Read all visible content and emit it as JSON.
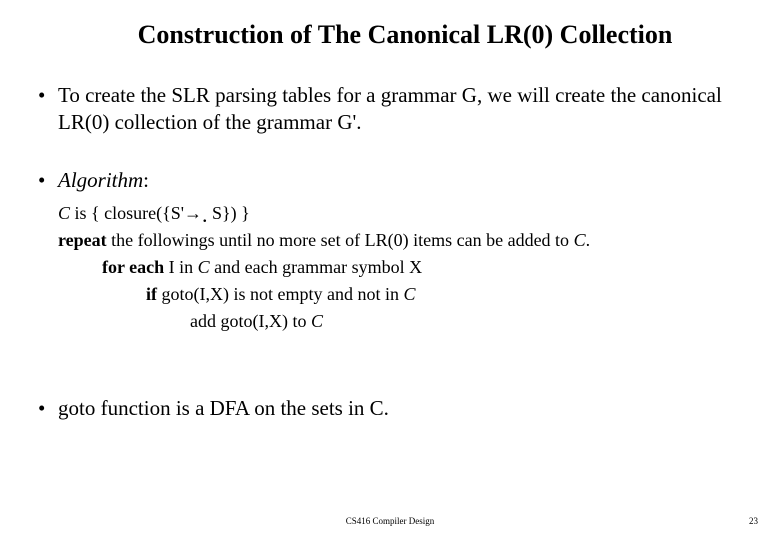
{
  "title": "Construction of The Canonical LR(0) Collection",
  "bullets": {
    "intro": "To create the SLR parsing tables for a grammar G, we will create the canonical LR(0) collection of the grammar G'.",
    "algorithm_label": "Algorithm",
    "goto_note": "goto function is a DFA on the sets in C."
  },
  "algorithm": {
    "c_is_prefix": "C",
    "c_is_text": " is { closure({S'",
    "c_is_suffix": " S}) }",
    "repeat_bold": "repeat",
    "repeat_rest": " the followings until no more set of LR(0) items can be added to ",
    "repeat_c": "C",
    "foreach_bold": "for each",
    "foreach_mid": " I in ",
    "foreach_c": "C",
    "foreach_rest": " and each grammar symbol X",
    "if_bold": "if",
    "if_mid": " goto(I,X) is not empty and not in ",
    "if_c": "C",
    "add_text": "add goto(I,X) to ",
    "add_c": "C"
  },
  "footer": {
    "course": "CS416 Compiler Design",
    "page": "23"
  }
}
